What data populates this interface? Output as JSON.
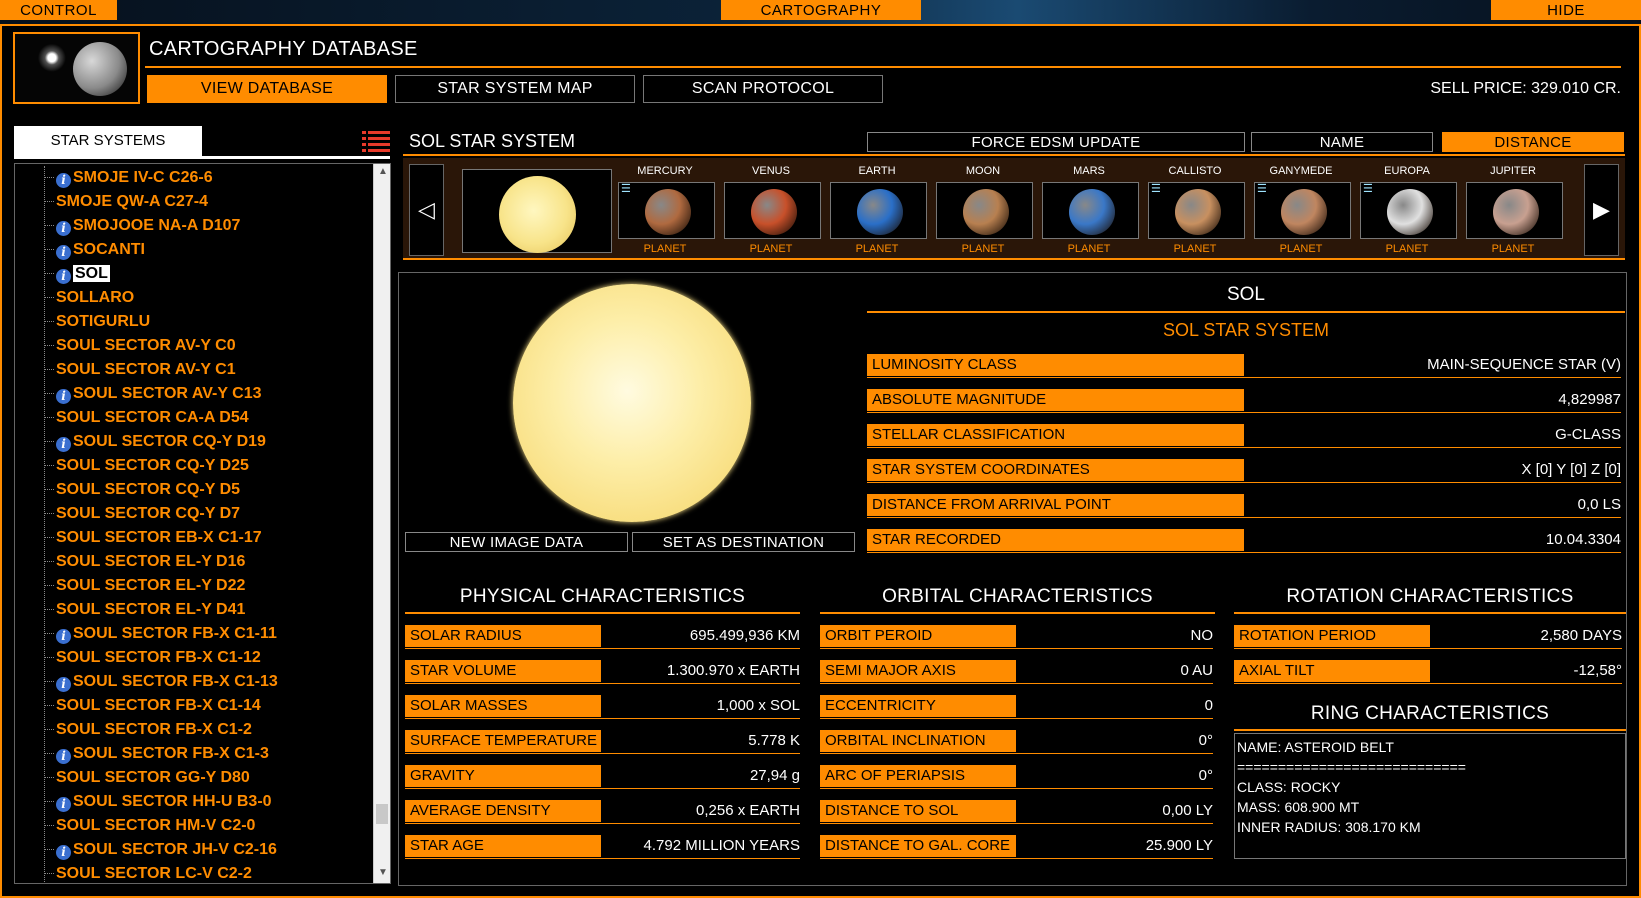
{
  "top_tabs": {
    "control": "CONTROL",
    "cartography": "CARTOGRAPHY",
    "hide": "HIDE"
  },
  "header": {
    "title": "CARTOGRAPHY DATABASE",
    "sell_price": "SELL PRICE: 329.010 CR."
  },
  "nav": {
    "view_database": "VIEW DATABASE",
    "star_system_map": "STAR SYSTEM MAP",
    "scan_protocol": "SCAN PROTOCOL"
  },
  "sidebar": {
    "tab_label": "STAR SYSTEMS",
    "items": [
      {
        "label": "SMOJE IV-C C26-6",
        "info": true
      },
      {
        "label": "SMOJE QW-A C27-4",
        "info": false
      },
      {
        "label": "SMOJOOE NA-A D107",
        "info": true
      },
      {
        "label": "SOCANTI",
        "info": true
      },
      {
        "label": "SOL",
        "info": true,
        "selected": true
      },
      {
        "label": "SOLLARO",
        "info": false
      },
      {
        "label": "SOTIGURLU",
        "info": false
      },
      {
        "label": "SOUL SECTOR AV-Y C0",
        "info": false
      },
      {
        "label": "SOUL SECTOR AV-Y C1",
        "info": false
      },
      {
        "label": "SOUL SECTOR AV-Y C13",
        "info": true
      },
      {
        "label": "SOUL SECTOR CA-A D54",
        "info": false
      },
      {
        "label": "SOUL SECTOR CQ-Y D19",
        "info": true
      },
      {
        "label": "SOUL SECTOR CQ-Y D25",
        "info": false
      },
      {
        "label": "SOUL SECTOR CQ-Y D5",
        "info": false
      },
      {
        "label": "SOUL SECTOR CQ-Y D7",
        "info": false
      },
      {
        "label": "SOUL SECTOR EB-X C1-17",
        "info": false
      },
      {
        "label": "SOUL SECTOR EL-Y D16",
        "info": false
      },
      {
        "label": "SOUL SECTOR EL-Y D22",
        "info": false
      },
      {
        "label": "SOUL SECTOR EL-Y D41",
        "info": false
      },
      {
        "label": "SOUL SECTOR FB-X C1-11",
        "info": true
      },
      {
        "label": "SOUL SECTOR FB-X C1-12",
        "info": false
      },
      {
        "label": "SOUL SECTOR FB-X C1-13",
        "info": true
      },
      {
        "label": "SOUL SECTOR FB-X C1-14",
        "info": false
      },
      {
        "label": "SOUL SECTOR FB-X C1-2",
        "info": false
      },
      {
        "label": "SOUL SECTOR FB-X C1-3",
        "info": true
      },
      {
        "label": "SOUL SECTOR GG-Y D80",
        "info": false
      },
      {
        "label": "SOUL SECTOR HH-U B3-0",
        "info": true
      },
      {
        "label": "SOUL SECTOR HM-V C2-0",
        "info": false
      },
      {
        "label": "SOUL SECTOR JH-V C2-16",
        "info": true
      },
      {
        "label": "SOUL SECTOR LC-V C2-2",
        "info": false
      }
    ]
  },
  "system": {
    "title": "SOL STAR SYSTEM",
    "force_update": "FORCE EDSM UPDATE",
    "sort_name": "NAME",
    "sort_distance": "DISTANCE",
    "bodies": [
      {
        "name": "MERCURY",
        "type": "PLANET",
        "lander": true,
        "color": "#b06a40"
      },
      {
        "name": "VENUS",
        "type": "PLANET",
        "lander": false,
        "color": "#c8502a"
      },
      {
        "name": "EARTH",
        "type": "PLANET",
        "lander": false,
        "color": "#2a6fc8"
      },
      {
        "name": "MOON",
        "type": "PLANET",
        "lander": false,
        "color": "#b88050"
      },
      {
        "name": "MARS",
        "type": "PLANET",
        "lander": false,
        "color": "#3a78c8"
      },
      {
        "name": "CALLISTO",
        "type": "PLANET",
        "lander": true,
        "color": "#c89060"
      },
      {
        "name": "GANYMEDE",
        "type": "PLANET",
        "lander": true,
        "color": "#c08660"
      },
      {
        "name": "EUROPA",
        "type": "PLANET",
        "lander": true,
        "color": "#e0e0e0"
      },
      {
        "name": "JUPITER",
        "type": "PLANET",
        "lander": false,
        "color": "#c8a090"
      }
    ]
  },
  "detail": {
    "name": "SOL",
    "system": "SOL STAR SYSTEM",
    "new_image": "NEW IMAGE DATA",
    "set_destination": "SET AS DESTINATION",
    "info": [
      {
        "label": "LUMINOSITY CLASS",
        "value": "MAIN-SEQUENCE STAR (V)"
      },
      {
        "label": "ABSOLUTE MAGNITUDE",
        "value": "4,829987"
      },
      {
        "label": "STELLAR CLASSIFICATION",
        "value": "G-CLASS"
      },
      {
        "label": "STAR SYSTEM COORDINATES",
        "value": "X [0]  Y [0]  Z [0]"
      },
      {
        "label": "DISTANCE FROM ARRIVAL POINT",
        "value": "0,0 LS"
      },
      {
        "label": "STAR RECORDED",
        "value": "10.04.3304"
      }
    ]
  },
  "physical": {
    "title": "PHYSICAL CHARACTERISTICS",
    "rows": [
      {
        "label": "SOLAR RADIUS",
        "value": "695.499,936 KM"
      },
      {
        "label": "STAR VOLUME",
        "value": "1.300.970 x EARTH"
      },
      {
        "label": "SOLAR MASSES",
        "value": "1,000 x SOL"
      },
      {
        "label": "SURFACE TEMPERATURE",
        "value": "5.778 K"
      },
      {
        "label": "GRAVITY",
        "value": "27,94 g"
      },
      {
        "label": "AVERAGE DENSITY",
        "value": "0,256 x EARTH"
      },
      {
        "label": "STAR AGE",
        "value": "4.792 MILLION YEARS"
      }
    ]
  },
  "orbital": {
    "title": "ORBITAL CHARACTERISTICS",
    "rows": [
      {
        "label": "ORBIT PEROID",
        "value": "NO"
      },
      {
        "label": "SEMI MAJOR AXIS",
        "value": "0 AU"
      },
      {
        "label": "ECCENTRICITY",
        "value": "0"
      },
      {
        "label": "ORBITAL INCLINATION",
        "value": "0°"
      },
      {
        "label": "ARC OF PERIAPSIS",
        "value": "0°"
      },
      {
        "label": "DISTANCE TO SOL",
        "value": "0,00 LY"
      },
      {
        "label": "DISTANCE TO GAL. CORE",
        "value": "25.900 LY"
      }
    ]
  },
  "rotation": {
    "title": "ROTATION CHARACTERISTICS",
    "rows": [
      {
        "label": "ROTATION PERIOD",
        "value": "2,580 DAYS"
      },
      {
        "label": "AXIAL TILT",
        "value": "-12,58°"
      }
    ]
  },
  "ring": {
    "title": "RING CHARACTERISTICS",
    "lines": [
      "NAME: ASTEROID BELT",
      "============================",
      "CLASS: ROCKY",
      "MASS: 608.900 MT",
      "INNER RADIUS: 308.170 KM"
    ]
  }
}
